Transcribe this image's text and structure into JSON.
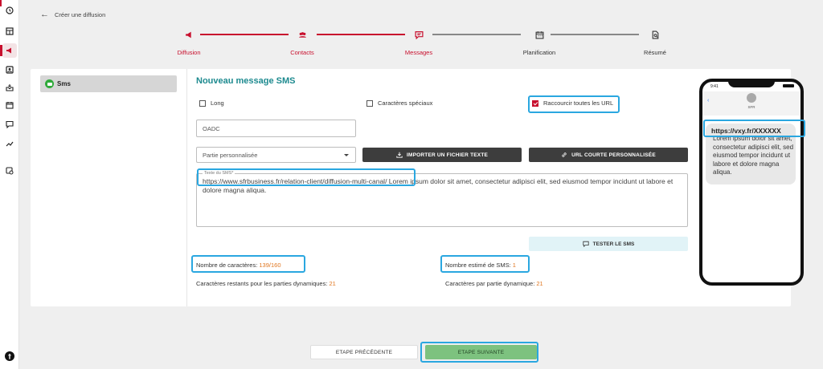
{
  "header": {
    "title": "Créer une diffusion"
  },
  "stepper": [
    {
      "label": "Diffusion",
      "icon": "megaphone-icon",
      "state": "done"
    },
    {
      "label": "Contacts",
      "icon": "users-icon",
      "state": "done"
    },
    {
      "label": "Messages",
      "icon": "message-icon",
      "state": "active"
    },
    {
      "label": "Planification",
      "icon": "calendar-icon",
      "state": "pending"
    },
    {
      "label": "Résumé",
      "icon": "summary-icon",
      "state": "pending"
    }
  ],
  "sidebar": {
    "active_item": "Sms"
  },
  "form": {
    "title": "Nouveau message SMS",
    "checkbox_long": {
      "label": "Long",
      "checked": false
    },
    "checkbox_special": {
      "label": "Caractères spéciaux",
      "checked": false
    },
    "checkbox_shorten": {
      "label": "Raccourcir toutes les URL",
      "checked": true
    },
    "oadc_placeholder": "OADC",
    "select_value": "Partie personnalisée",
    "import_button": "IMPORTER UN FICHIER TEXTE",
    "short_url_button": "URL COURTE PERSONNALISÉE",
    "sms_text_label": "Texte du SMS*",
    "sms_text_link": "https://www.sfrbusiness.fr/relation-client/diffusion-multi-canal/",
    "sms_text_rest": " Lorem ipsum dolor sit amet, consectetur adipisci elit, sed eiusmod tempor incidunt ut labore et dolore magna aliqua.",
    "test_button": "TESTER LE SMS"
  },
  "stats": {
    "char_count_label": "Nombre de caractères: ",
    "char_count_value": "139/160",
    "remaining_label": "Caractères restants pour les parties dynamiques: ",
    "remaining_value": "21",
    "sms_count_label": "Nombre estimé de SMS: ",
    "sms_count_value": "1",
    "per_part_label": "Caractères par partie dynamique: ",
    "per_part_value": "21"
  },
  "phone": {
    "time": "9:41",
    "contact": "SFR",
    "link": "https://vxy.fr/XXXXXX",
    "message": "Lorem ipsum dolor sit amet, consectetur adipisci elit, sed eiusmod tempor incidunt ut labore et dolore magna aliqua."
  },
  "footer": {
    "prev_button": "ETAPE PRÉCÉDENTE",
    "next_button": "ETAPE SUIVANTE"
  },
  "colors": {
    "brand_red": "#c8102e",
    "title_teal": "#1d8a8f",
    "highlight": "#2aa7e0",
    "next_green": "#7dc27f",
    "count_orange": "#e0761f"
  }
}
